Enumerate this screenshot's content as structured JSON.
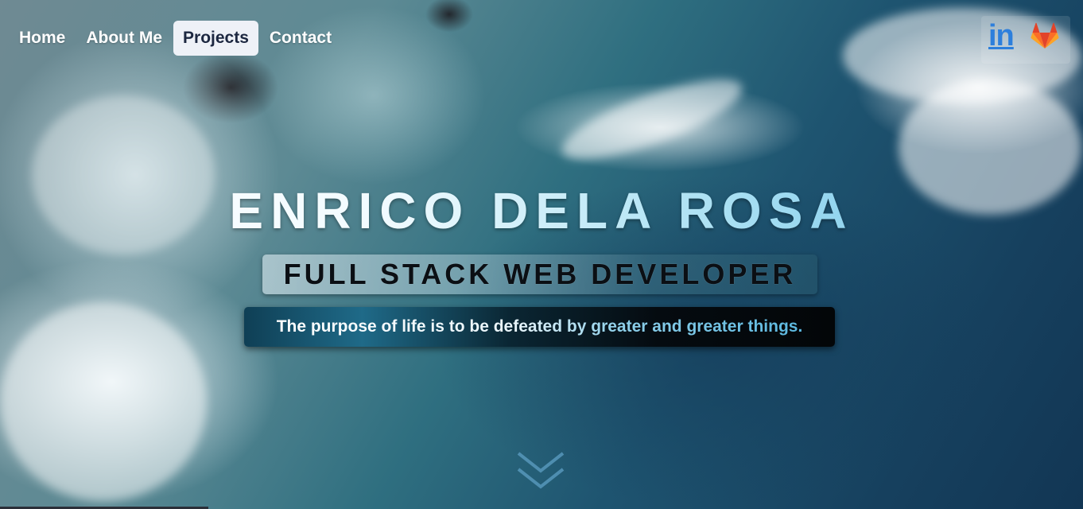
{
  "nav": {
    "items": [
      {
        "label": "Home",
        "active": false
      },
      {
        "label": "About Me",
        "active": false
      },
      {
        "label": "Projects",
        "active": true
      },
      {
        "label": "Contact",
        "active": false
      }
    ]
  },
  "social": {
    "linkedin_label": "in",
    "linkedin_icon": "linkedin-icon",
    "gitlab_icon": "gitlab-icon"
  },
  "hero": {
    "name": "ENRICO DELA ROSA",
    "subtitle": "FULL STACK WEB DEVELOPER",
    "quote": "The purpose of life is to be defeated by greater and greater things."
  },
  "scroll": {
    "icon": "chevron-double-down-icon"
  },
  "colors": {
    "nav_active_bg": "#eef1f7",
    "linkedin": "#2d7fdc",
    "gitlab_orange": "#e24329"
  }
}
